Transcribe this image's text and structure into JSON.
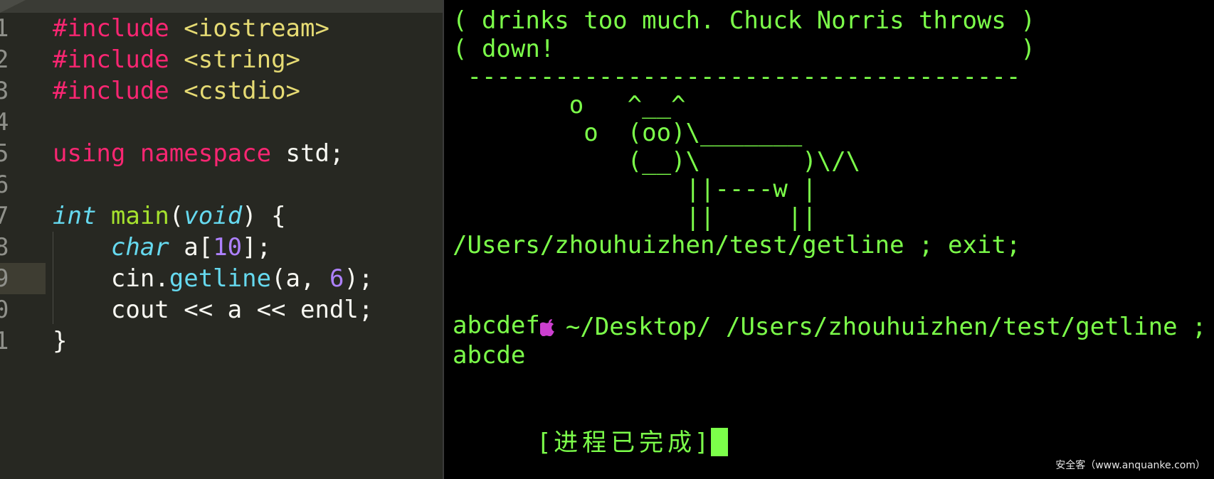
{
  "editor": {
    "lines": [
      {
        "num": "1",
        "tokens": [
          {
            "t": "#include",
            "c": "pp"
          },
          {
            "t": " ",
            "c": "plain"
          },
          {
            "t": "<iostream>",
            "c": "str"
          }
        ]
      },
      {
        "num": "2",
        "tokens": [
          {
            "t": "#include",
            "c": "pp"
          },
          {
            "t": " ",
            "c": "plain"
          },
          {
            "t": "<string>",
            "c": "str"
          }
        ]
      },
      {
        "num": "3",
        "tokens": [
          {
            "t": "#include",
            "c": "pp"
          },
          {
            "t": " ",
            "c": "plain"
          },
          {
            "t": "<cstdio>",
            "c": "str"
          }
        ]
      },
      {
        "num": "4",
        "tokens": []
      },
      {
        "num": "5",
        "tokens": [
          {
            "t": "using",
            "c": "kw"
          },
          {
            "t": " ",
            "c": "plain"
          },
          {
            "t": "namespace",
            "c": "kw"
          },
          {
            "t": " std;",
            "c": "plain"
          }
        ]
      },
      {
        "num": "6",
        "tokens": []
      },
      {
        "num": "7",
        "tokens": [
          {
            "t": "int",
            "c": "type"
          },
          {
            "t": " ",
            "c": "plain"
          },
          {
            "t": "main",
            "c": "fn"
          },
          {
            "t": "(",
            "c": "plain"
          },
          {
            "t": "void",
            "c": "type"
          },
          {
            "t": ") {",
            "c": "plain"
          }
        ]
      },
      {
        "num": "8",
        "tokens": [
          {
            "t": "    ",
            "c": "plain"
          },
          {
            "t": "char",
            "c": "type"
          },
          {
            "t": " a[",
            "c": "plain"
          },
          {
            "t": "10",
            "c": "num"
          },
          {
            "t": "];",
            "c": "plain"
          }
        ]
      },
      {
        "num": "9",
        "tokens": [
          {
            "t": "    cin.",
            "c": "plain"
          },
          {
            "t": "getline",
            "c": "call"
          },
          {
            "t": "(a, ",
            "c": "plain"
          },
          {
            "t": "6",
            "c": "num"
          },
          {
            "t": ");",
            "c": "plain"
          }
        ]
      },
      {
        "num": "0",
        "tokens": [
          {
            "t": "    cout << a << endl;",
            "c": "plain"
          }
        ]
      },
      {
        "num": "1",
        "tokens": [
          {
            "t": "}",
            "c": "plain"
          }
        ]
      }
    ]
  },
  "terminal": {
    "lines": [
      "( drinks too much. Chuck Norris throws )",
      "( down!                                )",
      " --------------------------------------",
      "        o   ^__^",
      "         o  (oo)\\_______",
      "            (__)\\       )\\/\\",
      "                ||----w |",
      "                ||     ||",
      "/Users/zhouhuizhen/test/getline ; exit;"
    ],
    "prompt_text": "~/Desktop/ /Users/zhouhuizhen/test/getline ; exit;",
    "output": [
      "abcdef",
      "abcde"
    ],
    "process_done": "[进程已完成]"
  },
  "watermark": "安全客（www.anquanke.com）",
  "colors": {
    "terminal_text": "#7cff4a",
    "editor_bg": "#272822",
    "apple": "#cc3fd0"
  }
}
